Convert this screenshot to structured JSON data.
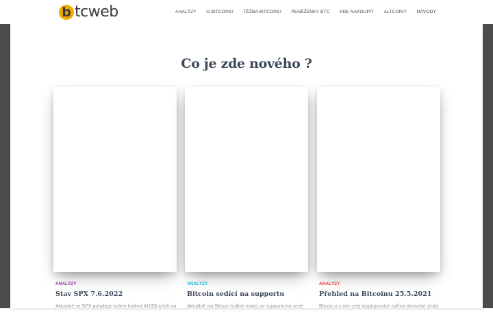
{
  "header": {
    "logo": {
      "letter": "b",
      "rest": "tcweb"
    },
    "nav": [
      "ANALÝZY",
      "O BITCOINU",
      "TĚŽBA BITCOINU",
      "PENĚŽENKY BTC",
      "KDE NAKOUPIT",
      "ALTCOINY",
      "NÁVODY"
    ]
  },
  "section": {
    "title": "Co je zde nového ?"
  },
  "cards": [
    {
      "category": "ANALÝZY",
      "category_color": "#9c27b0",
      "title": "Stav SPX 7.6.2022",
      "excerpt": "Aktuálně se SPX pohybuje kolem hodnot 4100$ a leží na"
    },
    {
      "category": "ANALÝZY",
      "category_color": "#00bcd4",
      "title": "Bitcoin sedící na supportu",
      "excerpt": "Aktuálně má Bitcoin bullish reakci ze supportu na ceně"
    },
    {
      "category": "ANALÝZY",
      "category_color": "#e53935",
      "title": "Přehled na Bitcoinu 25.5.2021",
      "excerpt": "Bitcoin a s ním celý kryptoprostor zažívá obrovské ztráty"
    }
  ],
  "colors": {
    "logo_coin": "#f2a900",
    "text_dark": "#3c4858",
    "page_background_edge": "#4c4c4c"
  }
}
